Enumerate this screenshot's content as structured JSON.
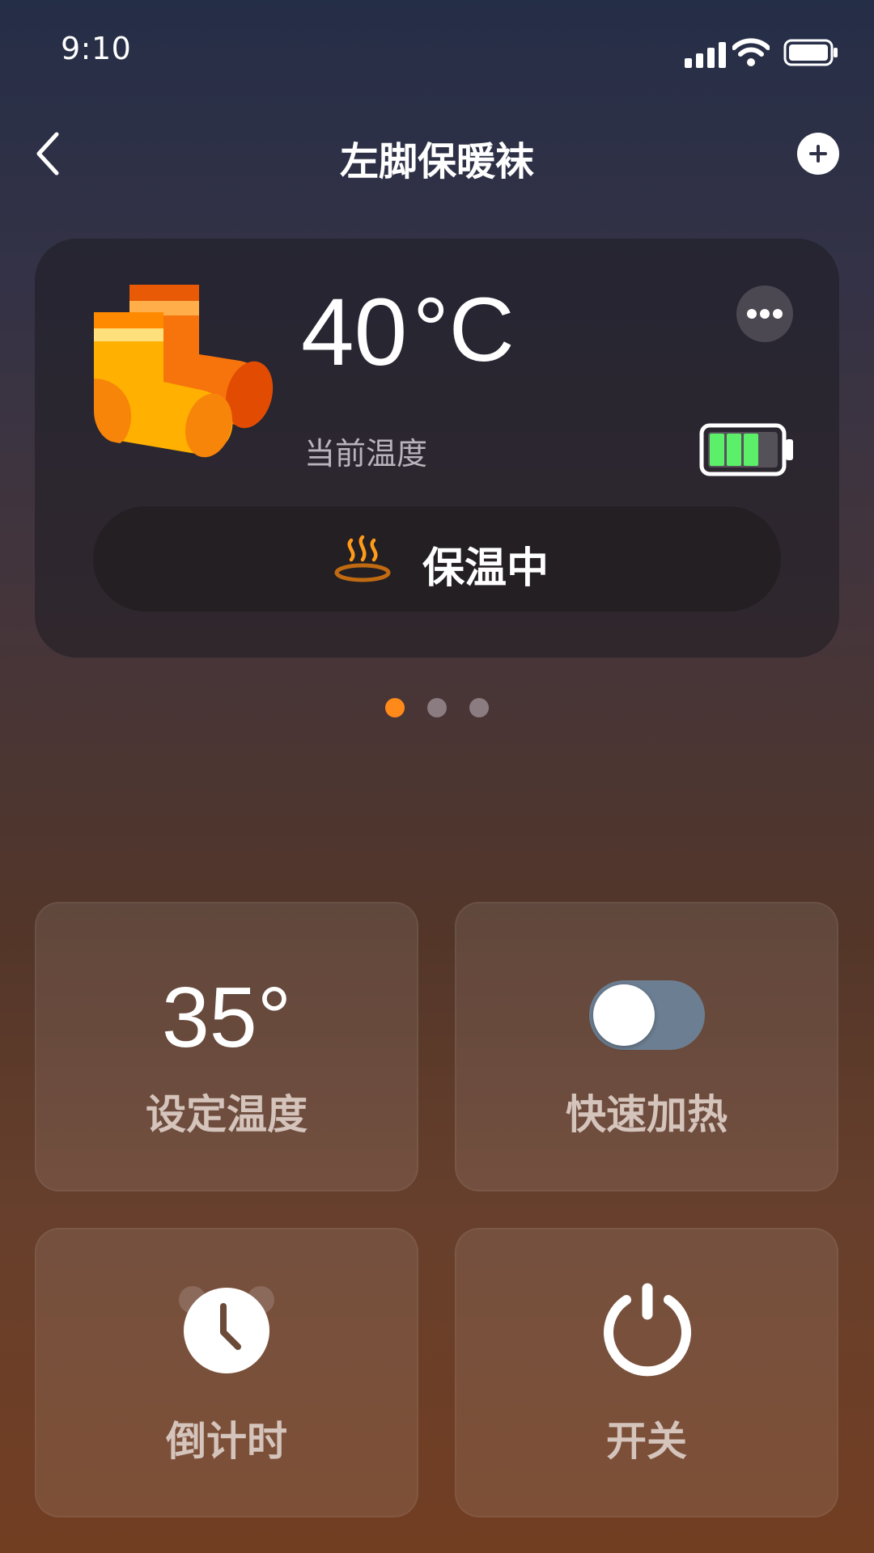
{
  "status_bar": {
    "time": "9:10",
    "icons": [
      "signal-icon",
      "wifi-icon",
      "battery-icon"
    ]
  },
  "header": {
    "title": "左脚保暖袜",
    "back_icon": "chevron-left-icon",
    "add_icon": "plus-icon"
  },
  "device_card": {
    "temperature": "40",
    "unit": "°C",
    "temperature_label": "当前温度",
    "battery_level": 0.75,
    "more_icon": "more-icon",
    "status_label": "保温中",
    "status_icon": "steam-icon"
  },
  "pagination": {
    "count": 3,
    "active_index": 0
  },
  "controls": {
    "set_temperature": {
      "value": "35°",
      "label": "设定温度"
    },
    "quick_heat": {
      "label": "快速加热",
      "enabled": false
    },
    "timer": {
      "label": "倒计时",
      "icon": "alarm-clock-icon"
    },
    "power": {
      "label": "开关",
      "icon": "power-icon"
    }
  },
  "colors": {
    "accent": "#ff8a1a",
    "battery_green": "#5cf06a",
    "toggle_track": "#6c7e92",
    "tile_label": "#d4c4bc"
  }
}
